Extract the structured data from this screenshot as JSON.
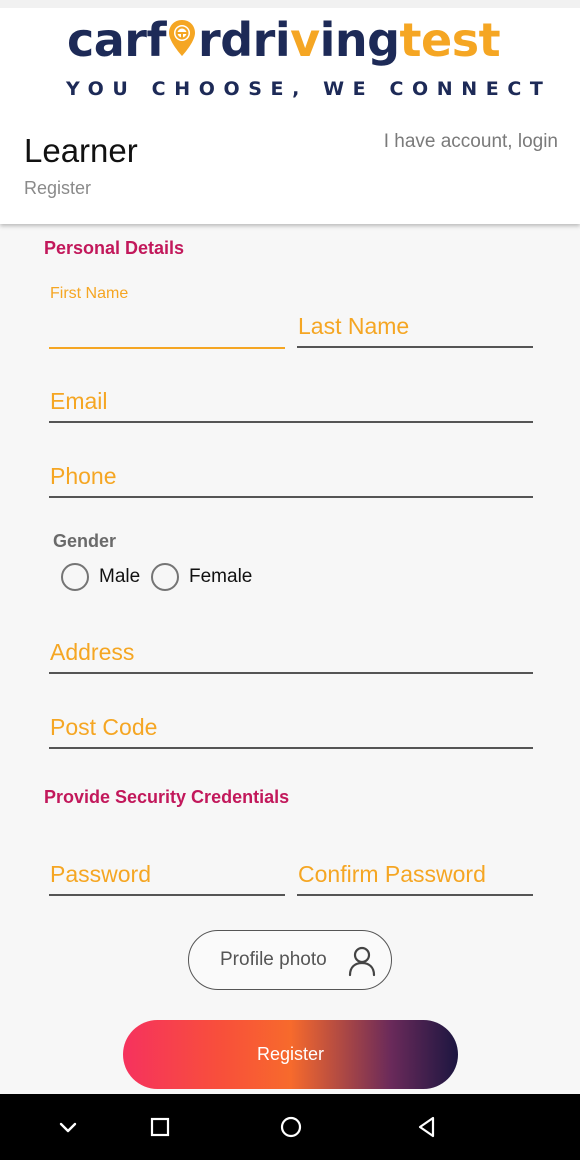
{
  "brand": {
    "logo_part1": "carf",
    "logo_part2": "rdri",
    "logo_part3": "ing",
    "logo_part4": "test",
    "tagline": "YOU CHOOSE, WE CONNECT",
    "navy": "#1d2a57",
    "orange": "#f5a623"
  },
  "header": {
    "title": "Learner",
    "subtitle": "Register",
    "login_link": "I have account, login"
  },
  "personal": {
    "section_title": "Personal Details",
    "first_name_label": "First Name",
    "first_name_value": "",
    "last_name_placeholder": "Last Name",
    "email_placeholder": "Email",
    "phone_placeholder": "Phone",
    "gender_label": "Gender",
    "gender_options": [
      "Male",
      "Female"
    ],
    "address_placeholder": "Address",
    "postcode_placeholder": "Post Code"
  },
  "security": {
    "section_title": "Provide Security Credentials",
    "password_placeholder": "Password",
    "confirm_placeholder": "Confirm Password"
  },
  "actions": {
    "profile_photo_label": "Profile photo",
    "profile_photo_icon": "user-icon",
    "register_label": "Register"
  },
  "system_nav": {
    "icons": [
      "chevron-down-icon",
      "recents-square-icon",
      "home-circle-icon",
      "back-triangle-icon"
    ]
  },
  "colors": {
    "accent": "#f5a623",
    "section": "#c2185b",
    "register_gradient": [
      "#f6325e",
      "#f76a2c",
      "#1c1640"
    ]
  }
}
